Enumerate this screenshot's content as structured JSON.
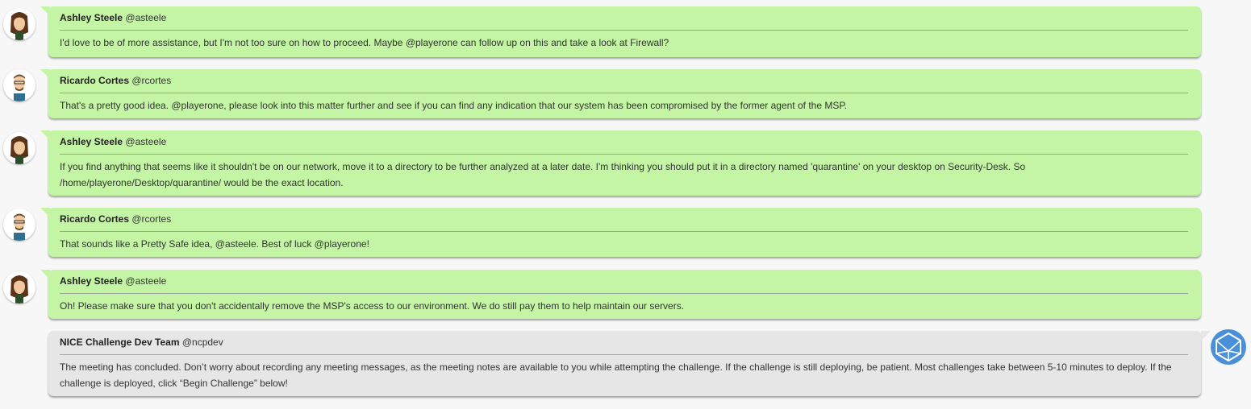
{
  "messages": [
    {
      "name": "Ashley Steele",
      "handle": "@asteele",
      "text": "I'd love to be of more assistance, but I'm not too sure on how to proceed. Maybe @playerone can follow up on this and take a look at Firewall?"
    },
    {
      "name": "Ricardo Cortes",
      "handle": "@rcortes",
      "text": "That's a pretty good idea. @playerone, please look into this matter further and see if you can find any indication that our system has been compromised by the former agent of the MSP."
    },
    {
      "name": "Ashley Steele",
      "handle": "@asteele",
      "text": "If you find anything that seems like it shouldn't be on our network, move it to a directory to be further analyzed at a later date. I'm thinking you should put it in a directory named 'quarantine' on your desktop on Security-Desk. So /home/playerone/Desktop/quarantine/ would be the exact location."
    },
    {
      "name": "Ricardo Cortes",
      "handle": "@rcortes",
      "text": "That sounds like a Pretty Safe idea, @asteele. Best of luck @playerone!"
    },
    {
      "name": "Ashley Steele",
      "handle": "@asteele",
      "text": "Oh! Please make sure that you don't accidentally remove the MSP's access to our environment. We do still pay them to help maintain our servers."
    },
    {
      "name": "NICE Challenge Dev Team",
      "handle": "@ncpdev",
      "text": "The meeting has concluded. Don’t worry about recording any meeting messages, as the meeting notes are available to you while attempting the challenge. If the challenge is still deploying, be patient. Most challenges take between 5-10 minutes to deploy. If the challenge is deployed, click “Begin Challenge” below!"
    }
  ],
  "colors": {
    "user_bubble": "#c3f5a4",
    "system_bubble": "#e6e6e6",
    "bot_icon": "#4a90d9"
  }
}
